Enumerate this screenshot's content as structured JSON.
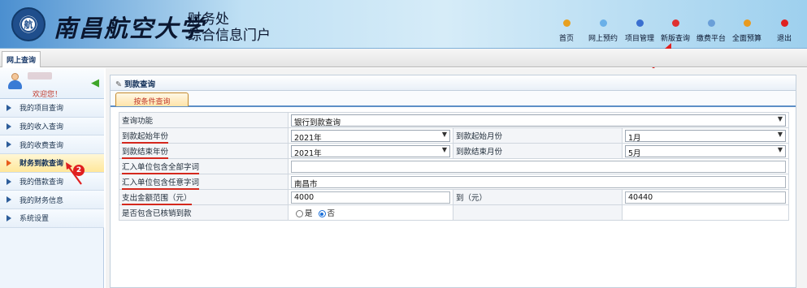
{
  "header": {
    "university_name": "南昌航空大学",
    "logo_text": "航",
    "system_line1": "财务处",
    "system_line2": "综合信息门户"
  },
  "topnav": [
    {
      "label": "首页",
      "color": "#e8a020",
      "icon": "home-icon"
    },
    {
      "label": "网上预约",
      "color": "#6ab0e8",
      "icon": "calendar-icon"
    },
    {
      "label": "项目管理",
      "color": "#3a6fd0",
      "icon": "folder-icon"
    },
    {
      "label": "新版查询",
      "color": "#e03030",
      "icon": "search-icon"
    },
    {
      "label": "缴费平台",
      "color": "#6a9fd8",
      "icon": "payment-icon"
    },
    {
      "label": "全面预算",
      "color": "#e89a20",
      "icon": "budget-icon"
    },
    {
      "label": "退出",
      "color": "#e02020",
      "icon": "logout-icon"
    }
  ],
  "annotations": {
    "marker1": "1",
    "marker2": "2"
  },
  "tabbar": {
    "active_tab": "网上查询"
  },
  "sidebar": {
    "welcome": "欢迎您！",
    "items": [
      {
        "label": "我的项目查询",
        "active": false
      },
      {
        "label": "我的收入查询",
        "active": false
      },
      {
        "label": "我的收费查询",
        "active": false
      },
      {
        "label": "财务到款查询",
        "active": true
      },
      {
        "label": "我的借款查询",
        "active": false
      },
      {
        "label": "我的财务信息",
        "active": false
      },
      {
        "label": "系统设置",
        "active": false
      }
    ]
  },
  "main": {
    "panel_title": "到款查询",
    "subtab_label": "按条件查询",
    "form": {
      "func_label": "查询功能",
      "func_value": "银行到款查询",
      "start_year_label": "到款起始年份",
      "start_year_value": "2021年",
      "start_month_label": "到款起始月份",
      "start_month_value": "1月",
      "end_year_label": "到款结束年份",
      "end_year_value": "2021年",
      "end_month_label": "到款结束月份",
      "end_month_value": "5月",
      "unit_all_label": "汇入单位包含全部字词",
      "unit_all_value": "",
      "unit_any_label": "汇入单位包含任意字词",
      "unit_any_value": "南昌市",
      "amount_label": "支出金额范围（元）",
      "amount_from": "4000",
      "amount_to_label": "到（元）",
      "amount_to": "40440",
      "writeoff_label": "是否包含已核销到款",
      "opt_yes": "是",
      "opt_no": "否",
      "writeoff_selected": "否"
    }
  }
}
